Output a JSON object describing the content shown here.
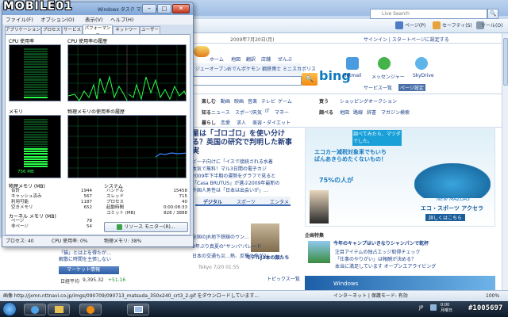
{
  "watermark_logo": "MOBILE01",
  "watermark_id": "#1005697",
  "browser": {
    "search_placeholder": "Live Search",
    "command_bar": [
      "ページ(P)",
      "セーフティ(S)",
      "ツール(O)"
    ],
    "statusbar_text": "画像 http://jxmn.nttnavi.co.jp/imgs/090709/090713_matsuda_350x240_crt3_2.gif をダウンロードしています...",
    "statusbar_zone": "インターネット | 保護モード: 有効",
    "statusbar_zoom": "100%"
  },
  "msn": {
    "date_line": "2009年7月20日(月)",
    "top_links": "サインイン | スタートページに設定する",
    "nav": [
      "ホーム",
      "地図",
      "翻訳",
      "店舗",
      "ぜんぶ"
    ],
    "search_tabs": [
      "ジューオーブン",
      "おでん",
      "ポケモン",
      "鋼鉄博士",
      "ミニスカポリス"
    ],
    "bing": "bing",
    "apps": [
      "Hotmail",
      "メッセンジャー",
      "SkyDrive"
    ],
    "service_btn": "サービス一覧",
    "page_settings": "ページ設定",
    "cats1": [
      "楽しむ",
      "動画",
      "映画",
      "音楽",
      "テレビ",
      "ゲーム"
    ],
    "cats2": [
      "知る",
      "ニュース",
      "スポーツ",
      "天気",
      "IT",
      "マネー"
    ],
    "cats3": [
      "暮らし",
      "恋愛",
      "求人",
      "美容・ダイエット"
    ],
    "shop1": [
      "買う",
      "ショッピング",
      "オークション"
    ],
    "shop2": [
      "調べる",
      "地図",
      "路線",
      "辞書",
      "マガジン検索"
    ],
    "headline": "星は「ゴロゴロ」を使い分ける？英国の研究で判明した新事実",
    "news_items": [
      "ビーチ向けに「イスで接続される水着",
      "本気で無料！マル3日間の電子カジ",
      "2009年下半期の運勢をグラフで見ると",
      "「Casa BRUTUS」が選ぶ2009年最新の",
      "外国人男性は「日本は出会いが」…"
    ],
    "tabs": [
      "デジタル",
      "スポーツ",
      "エンタメ"
    ],
    "ad_copy1": "調べてみたら、マツダでした。",
    "ad_copy2": "エコカー減税対象車でもいちばんあきらめたくないもの！",
    "ad_pct": "75%の人が",
    "ad_model": "NEW MAZDA3",
    "ad_brand": "エコ・スポーツ アクセラ",
    "ad_more": "詳しくはこちら",
    "market": "マーケット情報",
    "nikkei_label": "日経平均",
    "nikkei_val": "9,395.32",
    "nikkei_chg": "+51.16",
    "special": "企画特集",
    "special_head": "今年のキャンプはいきなりシャンパンで乾杯",
    "special_items": [
      "注目アイテムの独占エッジ取得チェック",
      "「仕事のやりがい」は報酬が決める？",
      "本当に満足しています オープンエアライビング"
    ],
    "model_caption": "モデルJ3本の顔たち",
    "topics_link": "トピックス一覧",
    "date_small": "Tokyo 7/20 01:55",
    "windows": "Windows",
    "news_left": [
      "「猫」とは上を得たが…",
      "解散に時間を主張しない"
    ],
    "news_mid": [
      "全国のJR地下鉄線のウン…",
      "8年ぶり真夏の\"サンバ\"パレード",
      "日本の交通も災…熱、反撃の声が2…"
    ]
  },
  "taskmgr": {
    "title": "Windows タスク マネージャ",
    "menu": [
      "ファイル(F)",
      "オプション(O)",
      "表示(V)",
      "ヘルプ(H)"
    ],
    "tabs": [
      "アプリケーション",
      "プロセス",
      "サービス",
      "パフォーマンス",
      "ネットワーク",
      "ユーザー"
    ],
    "active_tab": 3,
    "cpu_label": "CPU 使用率",
    "cpu_hist_label": "CPU 使用率の履歴",
    "mem_label": "メモリ",
    "mem_hist_label": "物理メモリの使用率の履歴",
    "cpu_percent": 38,
    "mem_percent": 38,
    "mem_value": "756 MB",
    "physmem_header": "物理メモリ (MB)",
    "physmem": [
      [
        "合計",
        "1944"
      ],
      [
        "キャッシュ済み",
        "567"
      ],
      [
        "利用可能",
        "1187"
      ],
      [
        "空きメモリ",
        "652"
      ]
    ],
    "system_header": "システム",
    "system": [
      [
        "ハンドル",
        "15458"
      ],
      [
        "スレッド",
        "715"
      ],
      [
        "プロセス",
        "40"
      ],
      [
        "起動時間",
        "0:00:08:33"
      ],
      [
        "コミット (MB)",
        "828 / 3888"
      ]
    ],
    "kernel_header": "カーネル メモリ (MB)",
    "kernel": [
      [
        "ページ",
        "78"
      ],
      [
        "非ページ",
        "54"
      ]
    ],
    "resource_btn": "リソース モニター(R)...",
    "status": {
      "proc": "プロセス: 40",
      "cpu": "CPU 使用率: 0%",
      "mem": "物理メモリ: 38%"
    }
  },
  "taskbar": {
    "clock_time": "0:00",
    "clock_day": "月曜日",
    "clock_date": "2009/07/20",
    "lang": "JP"
  }
}
